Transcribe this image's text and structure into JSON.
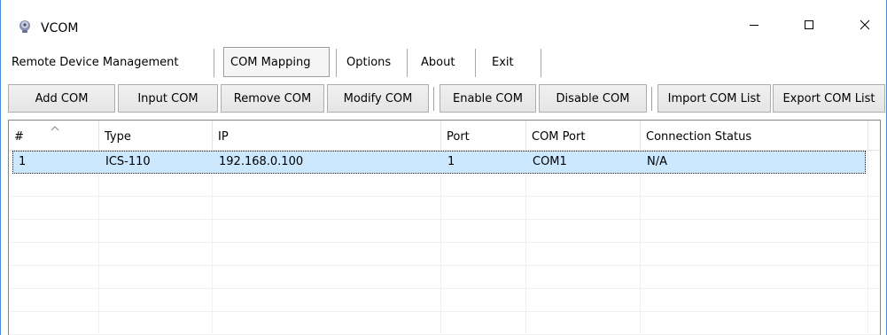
{
  "window": {
    "title": "VCOM",
    "icon": "vcom-app-icon",
    "controls": [
      "minimize-icon",
      "maximize-icon",
      "close-icon"
    ]
  },
  "menu": {
    "items": [
      {
        "label": "Remote Device Management",
        "active": false
      },
      {
        "label": "COM Mapping",
        "active": true
      },
      {
        "label": "Options",
        "active": false
      },
      {
        "label": "About",
        "active": false
      },
      {
        "label": "Exit",
        "active": false
      }
    ]
  },
  "toolbar": {
    "add_com": "Add COM",
    "input_com": "Input COM",
    "remove_com": "Remove COM",
    "modify_com": "Modify COM",
    "enable_com": "Enable COM",
    "disable_com": "Disable COM",
    "import_com_list": "Import COM List",
    "export_com_list": "Export COM List"
  },
  "table": {
    "columns": [
      "#",
      "Type",
      "IP",
      "Port",
      "COM Port",
      "Connection Status"
    ],
    "sort_indicator": "sort-ascending-icon",
    "rows": [
      {
        "num": "1",
        "type": "ICS-110",
        "ip": "192.168.0.100",
        "port": "1",
        "com_port": "COM1",
        "status": "N/A",
        "selected": true
      }
    ]
  },
  "colors": {
    "selection": "#cce8ff",
    "window_border": "#4a8bd8"
  }
}
